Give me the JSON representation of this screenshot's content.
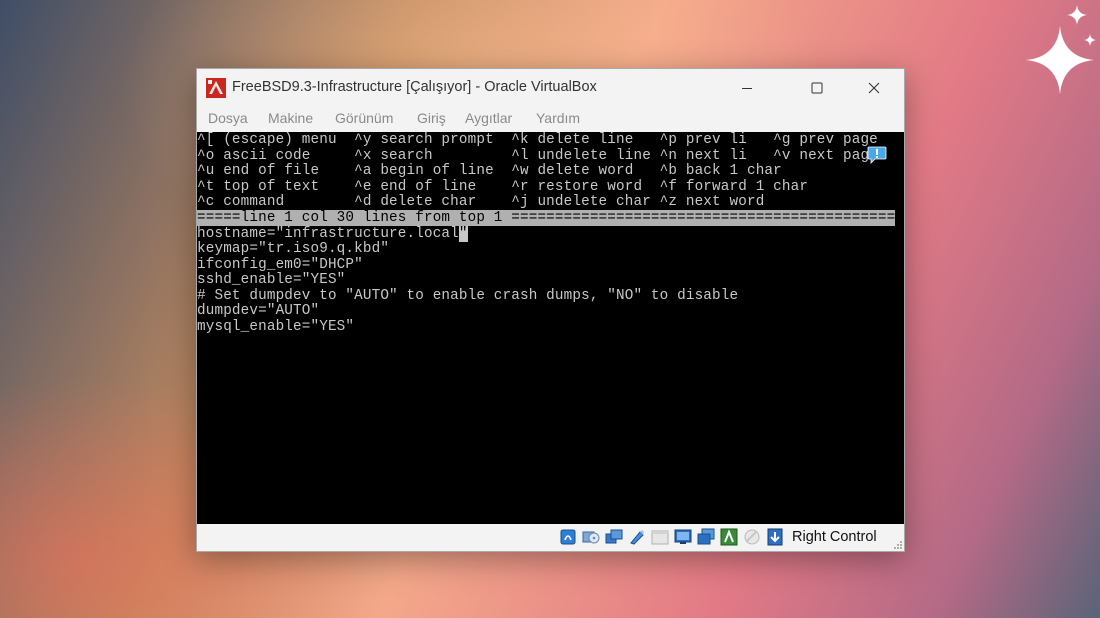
{
  "window": {
    "title": "FreeBSD9.3-Infrastructure [Çalışıyor] - Oracle VirtualBox",
    "controls": {
      "minimize": "—",
      "maximize": "☐",
      "close": "✕"
    }
  },
  "menu": [
    "Dosya",
    "Makine",
    "Görünüm",
    "Giriş",
    "Aygıtlar",
    "Yardım"
  ],
  "terminal": {
    "help_lines": [
      "^[ (escape) menu  ^y search prompt  ^k delete line   ^p prev li   ^g prev page",
      "^o ascii code     ^x search         ^l undelete line ^n next li   ^v next page",
      "^u end of file    ^a begin of line  ^w delete word   ^b back 1 char",
      "^t top of text    ^e end of line    ^r restore word  ^f forward 1 char",
      "^c command        ^d delete char    ^j undelete char ^z next word"
    ],
    "status_line": "=====line 1 col 30 lines from top 1 ============================================",
    "content_first_line": "hostname=\"infrastructure.local",
    "cursor_char": "\"",
    "content_lines": [
      "keymap=\"tr.iso9.q.kbd\"",
      "ifconfig_em0=\"DHCP\"",
      "sshd_enable=\"YES\"",
      "# Set dumpdev to \"AUTO\" to enable crash dumps, \"NO\" to disable",
      "dumpdev=\"AUTO\"",
      "mysql_enable=\"YES\""
    ]
  },
  "statusbar": {
    "host_key": "Right Control",
    "icons": [
      "hard-disk-icon",
      "optical-drive-icon",
      "network-icon",
      "usb-icon",
      "shared-folders-icon",
      "display-icon",
      "video-capture-icon",
      "recording-icon",
      "cpu-icon",
      "mouse-integration-icon",
      "keyboard-capture-icon"
    ]
  },
  "colors": {
    "terminal_bg": "#000000",
    "terminal_fg": "#c8c8c8",
    "status_line_bg": "#b0b0b0",
    "chrome_bg": "#f3f3f3"
  }
}
